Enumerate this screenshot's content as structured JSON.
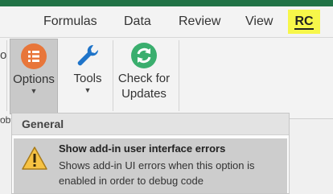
{
  "tabs": [
    {
      "label": "Formulas"
    },
    {
      "label": "Data"
    },
    {
      "label": "Review"
    },
    {
      "label": "View"
    },
    {
      "label": "RC"
    }
  ],
  "ribbon": {
    "options": {
      "label": "Options",
      "icon": "list-icon",
      "color": "#e8763a"
    },
    "tools": {
      "label": "Tools",
      "icon": "wrench-icon",
      "color": "#1f74c9"
    },
    "check_updates": {
      "label_line1": "Check for",
      "label_line2": "Updates",
      "icon": "refresh-icon",
      "color": "#3aae6e"
    },
    "partial_left": "o",
    "partial_group": "ob"
  },
  "menu": {
    "header": "General",
    "items": [
      {
        "icon": "warning-icon",
        "title": "Show add-in user interface errors",
        "description": "Shows add-in UI errors when this option is enabled in order to debug code"
      }
    ]
  },
  "colors": {
    "accent_green": "#217346",
    "highlight": "#f7f74a"
  }
}
